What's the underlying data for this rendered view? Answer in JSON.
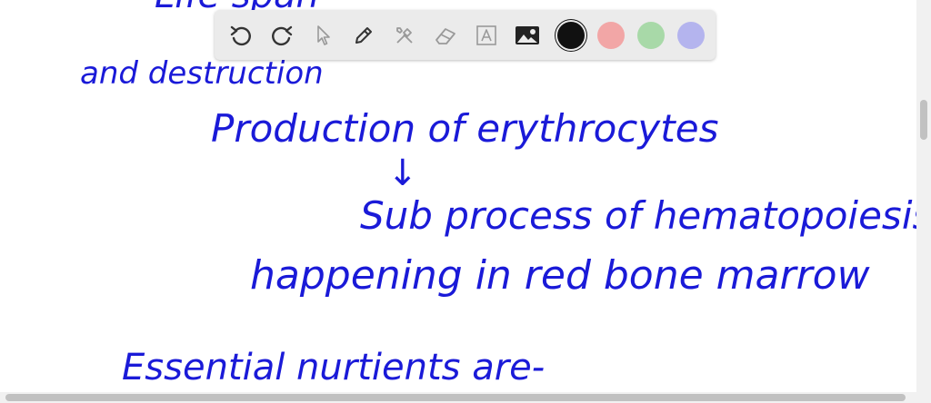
{
  "notes": {
    "line_top_partial": "Life span",
    "line1": "and destruction",
    "line2": "Production of erythrocytes",
    "arrow": "↓",
    "line3": "Sub process of hematopoiesis",
    "line4": "happening in red bone marrow",
    "line5": "Essential nurtients are-"
  },
  "toolbar": {
    "tools": [
      "undo-icon",
      "redo-icon",
      "pointer-icon",
      "pen-icon",
      "tools-icon",
      "eraser-icon",
      "text-icon",
      "image-icon"
    ],
    "colors": {
      "black": "#111111",
      "red": "#f2a6a6",
      "green": "#a8d9a8",
      "purple": "#b4b4ee"
    },
    "selected_color": "black"
  },
  "colors": {
    "ink": "#1a1ad8",
    "toolbar_bg": "#ebebeb"
  }
}
